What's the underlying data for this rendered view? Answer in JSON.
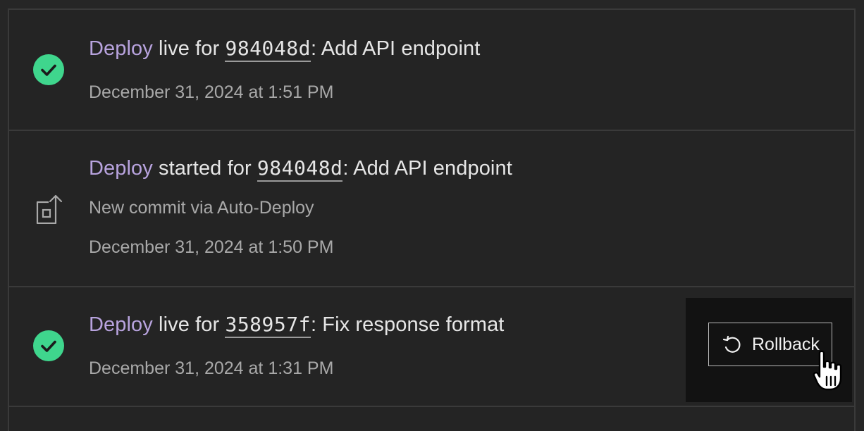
{
  "events": [
    {
      "link": "Deploy",
      "status": "live",
      "for_text": "for",
      "sha": "984048d",
      "message": ": Add API endpoint",
      "timestamp": "December 31, 2024 at 1:51 PM",
      "icon": "check-circle-icon"
    },
    {
      "link": "Deploy",
      "status": "started",
      "for_text": "for",
      "sha": "984048d",
      "message": ": Add API endpoint",
      "subtitle": "New commit via Auto-Deploy",
      "timestamp": "December 31, 2024 at 1:50 PM",
      "icon": "deploy-upload-icon"
    },
    {
      "link": "Deploy",
      "status": "live",
      "for_text": "for",
      "sha": "358957f",
      "message": ": Fix response format",
      "timestamp": "December 31, 2024 at 1:31 PM",
      "icon": "check-circle-icon"
    }
  ],
  "rollback": {
    "label": "Rollback",
    "icon": "undo-icon"
  },
  "colors": {
    "background": "#242424",
    "success": "#3fd68d",
    "link": "#b8a3de",
    "text": "#e6e6e6",
    "muted": "#a9a9a9"
  }
}
